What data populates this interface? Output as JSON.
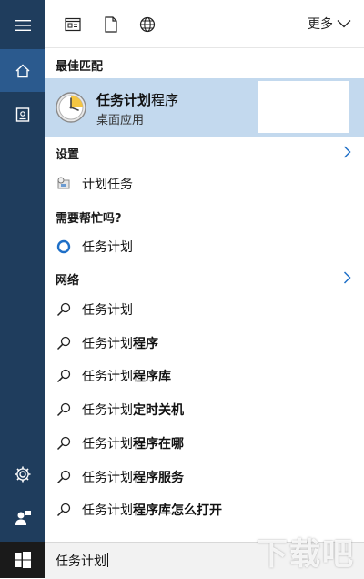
{
  "topbar": {
    "more_label": "更多",
    "icons": [
      "app-filter-icon",
      "document-filter-icon",
      "web-filter-icon"
    ]
  },
  "best_match": {
    "header": "最佳匹配",
    "name_highlight": "任务计划",
    "name_rest": "程序",
    "subtitle": "桌面应用"
  },
  "settings": {
    "header": "设置",
    "items": [
      {
        "label": "计划任务"
      }
    ]
  },
  "help": {
    "header": "需要帮忙吗?",
    "items": [
      {
        "label": "任务计划"
      }
    ]
  },
  "web": {
    "header": "网络",
    "items": [
      {
        "prefix": "任务计划",
        "suffix": ""
      },
      {
        "prefix": "任务计划",
        "suffix": "程序"
      },
      {
        "prefix": "任务计划",
        "suffix": "程序库"
      },
      {
        "prefix": "任务计划",
        "suffix": "定时关机"
      },
      {
        "prefix": "任务计划",
        "suffix": "程序在哪"
      },
      {
        "prefix": "任务计划",
        "suffix": "程序服务"
      },
      {
        "prefix": "任务计划",
        "suffix": "程序库怎么打开"
      }
    ]
  },
  "search": {
    "query": "任务计划"
  },
  "watermark": "下载吧",
  "colors": {
    "rail": "#1f3d5d",
    "rail_active": "#2b5a8e",
    "highlight": "#c3d9ee",
    "accent": "#1e6fc7"
  }
}
